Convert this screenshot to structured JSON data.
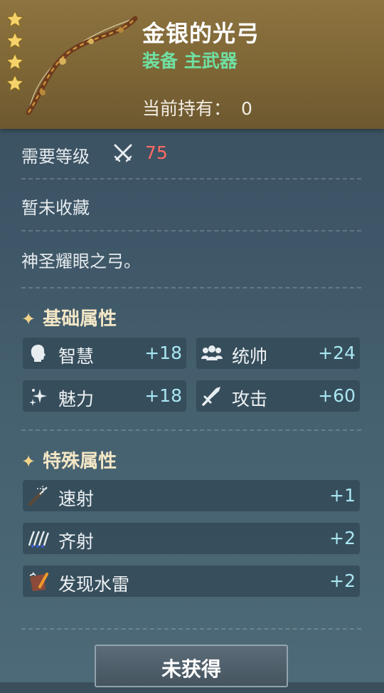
{
  "item": {
    "name": "金银的光弓",
    "type": "装备 主武器",
    "owned_label": "当前持有：",
    "owned_count": "0",
    "star_count": 4,
    "icons": [
      "star-icon",
      "bow-icon"
    ]
  },
  "requirement": {
    "label": "需要等级",
    "icon": "crossed-swords-icon",
    "value": "75",
    "value_color": "#ff6a63"
  },
  "collection_status": "暂未收藏",
  "description": "神圣耀眼之弓。",
  "base_attributes": {
    "title": "基础属性",
    "stats": [
      {
        "label": "智慧",
        "value": "+18",
        "icon": "head-icon"
      },
      {
        "label": "统帅",
        "value": "+24",
        "icon": "group-icon"
      },
      {
        "label": "魅力",
        "value": "+18",
        "icon": "sparkle-icon"
      },
      {
        "label": "攻击",
        "value": "+60",
        "icon": "sword-icon"
      }
    ]
  },
  "special_attributes": {
    "title": "特殊属性",
    "stats": [
      {
        "label": "速射",
        "value": "+1",
        "icon": "rapid-fire-icon"
      },
      {
        "label": "齐射",
        "value": "+2",
        "icon": "volley-icon"
      },
      {
        "label": "发现水雷",
        "value": "+2",
        "icon": "mine-detect-icon"
      }
    ]
  },
  "action_button": "未获得",
  "colors": {
    "header": "#7d6535",
    "type_text": "#6fe0a2",
    "stat_value": "#a9e6f2",
    "section_title": "#f4e7c6"
  }
}
